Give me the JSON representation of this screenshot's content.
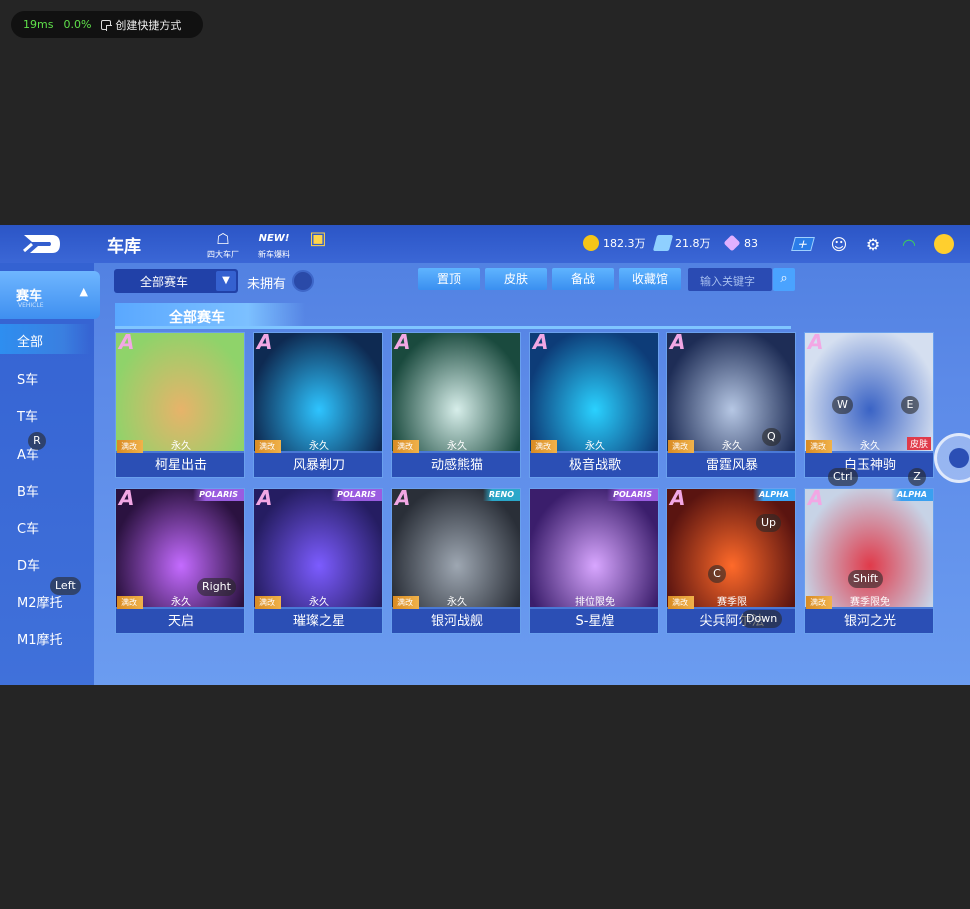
{
  "overlay": {
    "latency": "19ms",
    "cpu": "0.0%",
    "shortcut_label": "创建快捷方式"
  },
  "header": {
    "title": "车库",
    "icons": [
      {
        "label": "四大车厂",
        "icon": "car-factory-icon"
      },
      {
        "label": "新车爆料",
        "icon": "new-car-icon"
      },
      {
        "label": "",
        "icon": "gift-icon"
      }
    ],
    "currencies": [
      {
        "value": "182.3万",
        "icon": "coin-icon",
        "color": "#f5c518"
      },
      {
        "value": "21.8万",
        "icon": "voucher-icon",
        "color": "#8fd0ff"
      },
      {
        "value": "83",
        "icon": "diamond-icon",
        "color": "#e0b0ff"
      }
    ]
  },
  "sidebar": {
    "header": "赛车",
    "header_sub": "VEHICLE",
    "items": [
      "全部",
      "S车",
      "T车",
      "A车",
      "B车",
      "C车",
      "D车",
      "M2摩托",
      "M1摩托"
    ],
    "active": "全部"
  },
  "filters": {
    "selected": "全部赛车",
    "unowned_label": "未拥有",
    "buttons": [
      "置顶",
      "皮肤",
      "备战",
      "收藏馆"
    ],
    "search_placeholder": "输入关键字"
  },
  "section_title": "全部赛车",
  "cars": [
    {
      "name": "柯星出击",
      "duration": "永久",
      "mod": "满改",
      "tier": "A",
      "brand": "",
      "colors": [
        "#8fd36a",
        "#e7b36a"
      ]
    },
    {
      "name": "风暴剃刀",
      "duration": "永久",
      "mod": "满改",
      "tier": "A",
      "brand": "",
      "colors": [
        "#0e2a52",
        "#2ec4ff"
      ]
    },
    {
      "name": "动感熊猫",
      "duration": "永久",
      "mod": "满改",
      "tier": "A",
      "brand": "",
      "colors": [
        "#1a4a3e",
        "#d7eeea"
      ]
    },
    {
      "name": "极音战歌",
      "duration": "永久",
      "mod": "满改",
      "tier": "A",
      "brand": "",
      "colors": [
        "#0d3c78",
        "#2ad1ff"
      ]
    },
    {
      "name": "雷霆风暴",
      "duration": "永久",
      "mod": "满改",
      "tier": "A",
      "brand": "",
      "colors": [
        "#1e2d56",
        "#b6c7e4"
      ]
    },
    {
      "name": "白玉神驹",
      "duration": "永久",
      "mod": "满改",
      "tier": "A",
      "brand": "",
      "skin": "皮肤",
      "colors": [
        "#d5dff0",
        "#3a63c5"
      ]
    },
    {
      "name": "天启",
      "duration": "永久",
      "mod": "满改",
      "tier": "A",
      "brand": "POLARIS",
      "brand_color": "#9a5ce0",
      "colors": [
        "#2b1240",
        "#c46bff"
      ]
    },
    {
      "name": "璀璨之星",
      "duration": "永久",
      "mod": "满改",
      "tier": "A",
      "brand": "POLARIS",
      "brand_color": "#9a5ce0",
      "colors": [
        "#251d62",
        "#7c5cff"
      ]
    },
    {
      "name": "银河战舰",
      "duration": "永久",
      "mod": "满改",
      "tier": "A",
      "brand": "RENO",
      "brand_color": "#2aa7c9",
      "colors": [
        "#2a2f38",
        "#9ea7b2"
      ]
    },
    {
      "name": "S-星煌",
      "duration": "排位限免",
      "mod": "",
      "tier": "",
      "brand": "POLARIS",
      "brand_color": "#9a5ce0",
      "colors": [
        "#3b1e6c",
        "#d8a6ff"
      ]
    },
    {
      "name": "尖兵阿尔法",
      "duration": "赛季限",
      "mod": "满改",
      "tier": "A",
      "brand": "ALPHA",
      "brand_color": "#3aa0f0",
      "colors": [
        "#5a1410",
        "#ff6a2a"
      ]
    },
    {
      "name": "银河之光",
      "duration": "赛季限免",
      "mod": "满改",
      "tier": "A",
      "brand": "ALPHA",
      "brand_color": "#3aa0f0",
      "colors": [
        "#c7d3e6",
        "#e03a4a"
      ]
    }
  ],
  "key_overlays": [
    "R",
    "Left",
    "Right",
    "W",
    "E",
    "Q",
    "Ctrl",
    "Z",
    "Up",
    "C",
    "Shift",
    "Down"
  ]
}
